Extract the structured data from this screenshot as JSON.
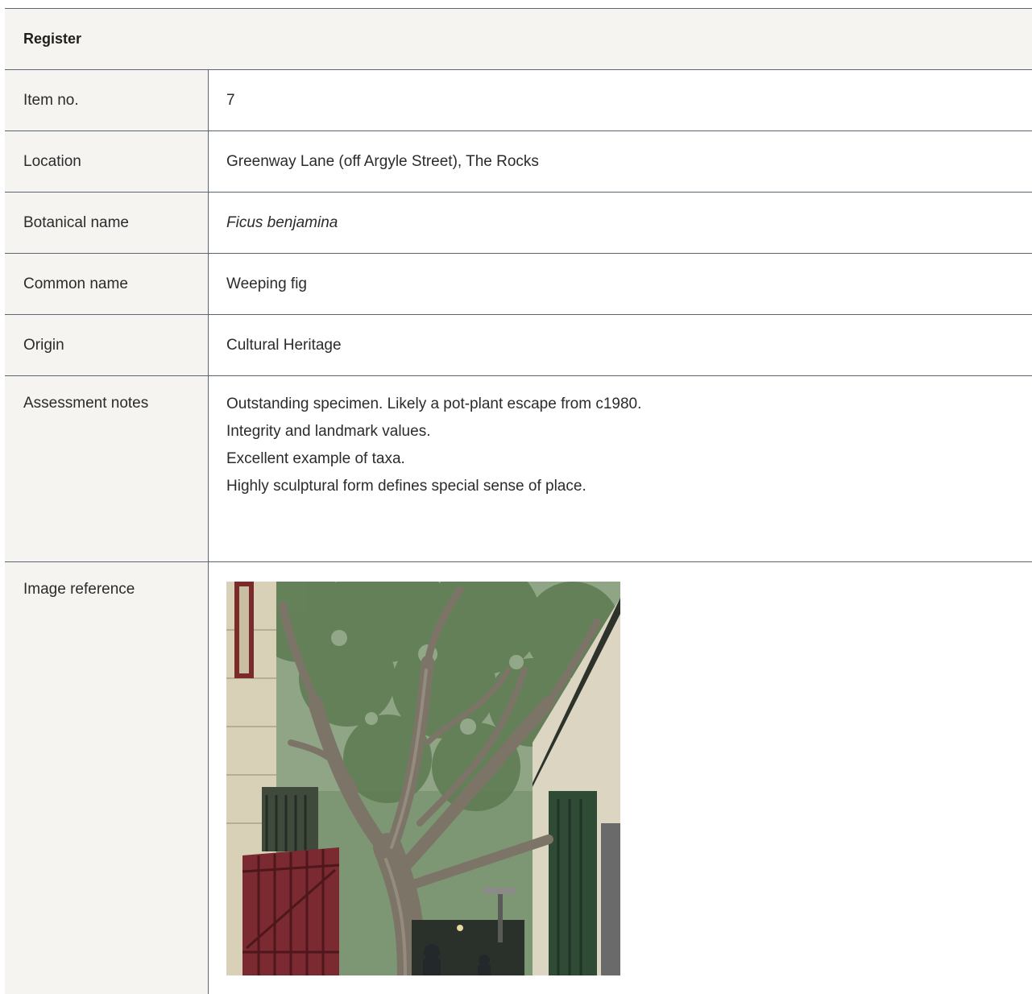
{
  "table": {
    "header": "Register",
    "rows": [
      {
        "label": "Item no.",
        "value": "7"
      },
      {
        "label": "Location",
        "value": "Greenway Lane (off Argyle Street), The Rocks"
      },
      {
        "label": "Botanical name",
        "value": "Ficus benjamina"
      },
      {
        "label": "Common name",
        "value": "Weeping fig"
      },
      {
        "label": "Origin",
        "value": "Cultural Heritage"
      }
    ],
    "notes": {
      "label": "Assessment notes",
      "lines": [
        "Outstanding specimen. Likely a pot-plant escape from c1980.",
        "Integrity and landmark values.",
        "Excellent example of taxa.",
        "Highly sculptural form defines special sense of place."
      ]
    },
    "image": {
      "label": "Image reference"
    }
  }
}
